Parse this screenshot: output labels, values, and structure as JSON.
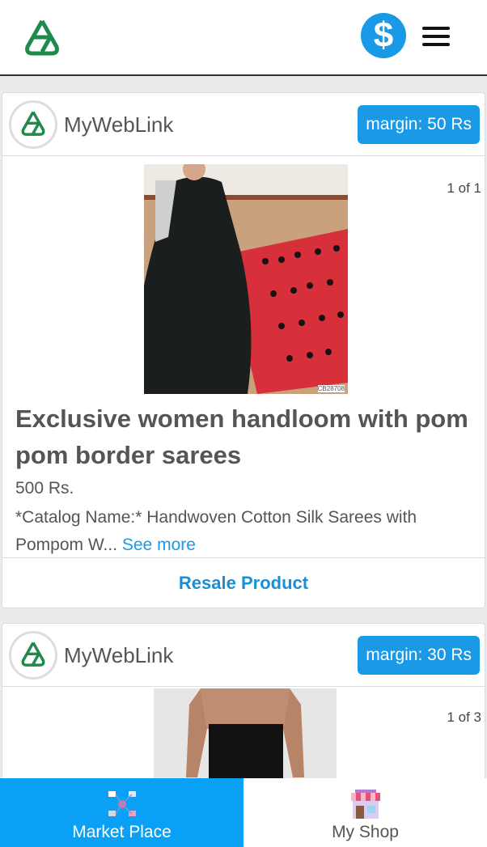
{
  "header": {
    "logo_icon": "triangle-knot-logo-icon",
    "wallet_icon": "dollar-icon",
    "dollar_symbol": "$",
    "menu_icon": "hamburger-menu-icon"
  },
  "products": [
    {
      "seller": "MyWebLink",
      "margin": "margin: 50 Rs",
      "image_counter": "1 of 1",
      "image_code": "CB28708",
      "title": "Exclusive women handloom with pom pom border sarees",
      "price": "500 Rs.",
      "description": "*Catalog Name:* Handwoven Cotton Silk Sarees with Pompom W...",
      "see_more": "See more",
      "action": "Resale Product"
    },
    {
      "seller": "MyWebLink",
      "margin": "margin: 30 Rs",
      "image_counter": "1 of 3"
    }
  ],
  "bottom_nav": [
    {
      "label": "Market Place",
      "icon": "marketplace-icon",
      "active": true
    },
    {
      "label": "My Shop",
      "icon": "shop-icon",
      "active": false
    }
  ],
  "colors": {
    "accent": "#1a9ae6",
    "logo_green": "#1f8a4c",
    "nav_active": "#0aa0f5"
  }
}
